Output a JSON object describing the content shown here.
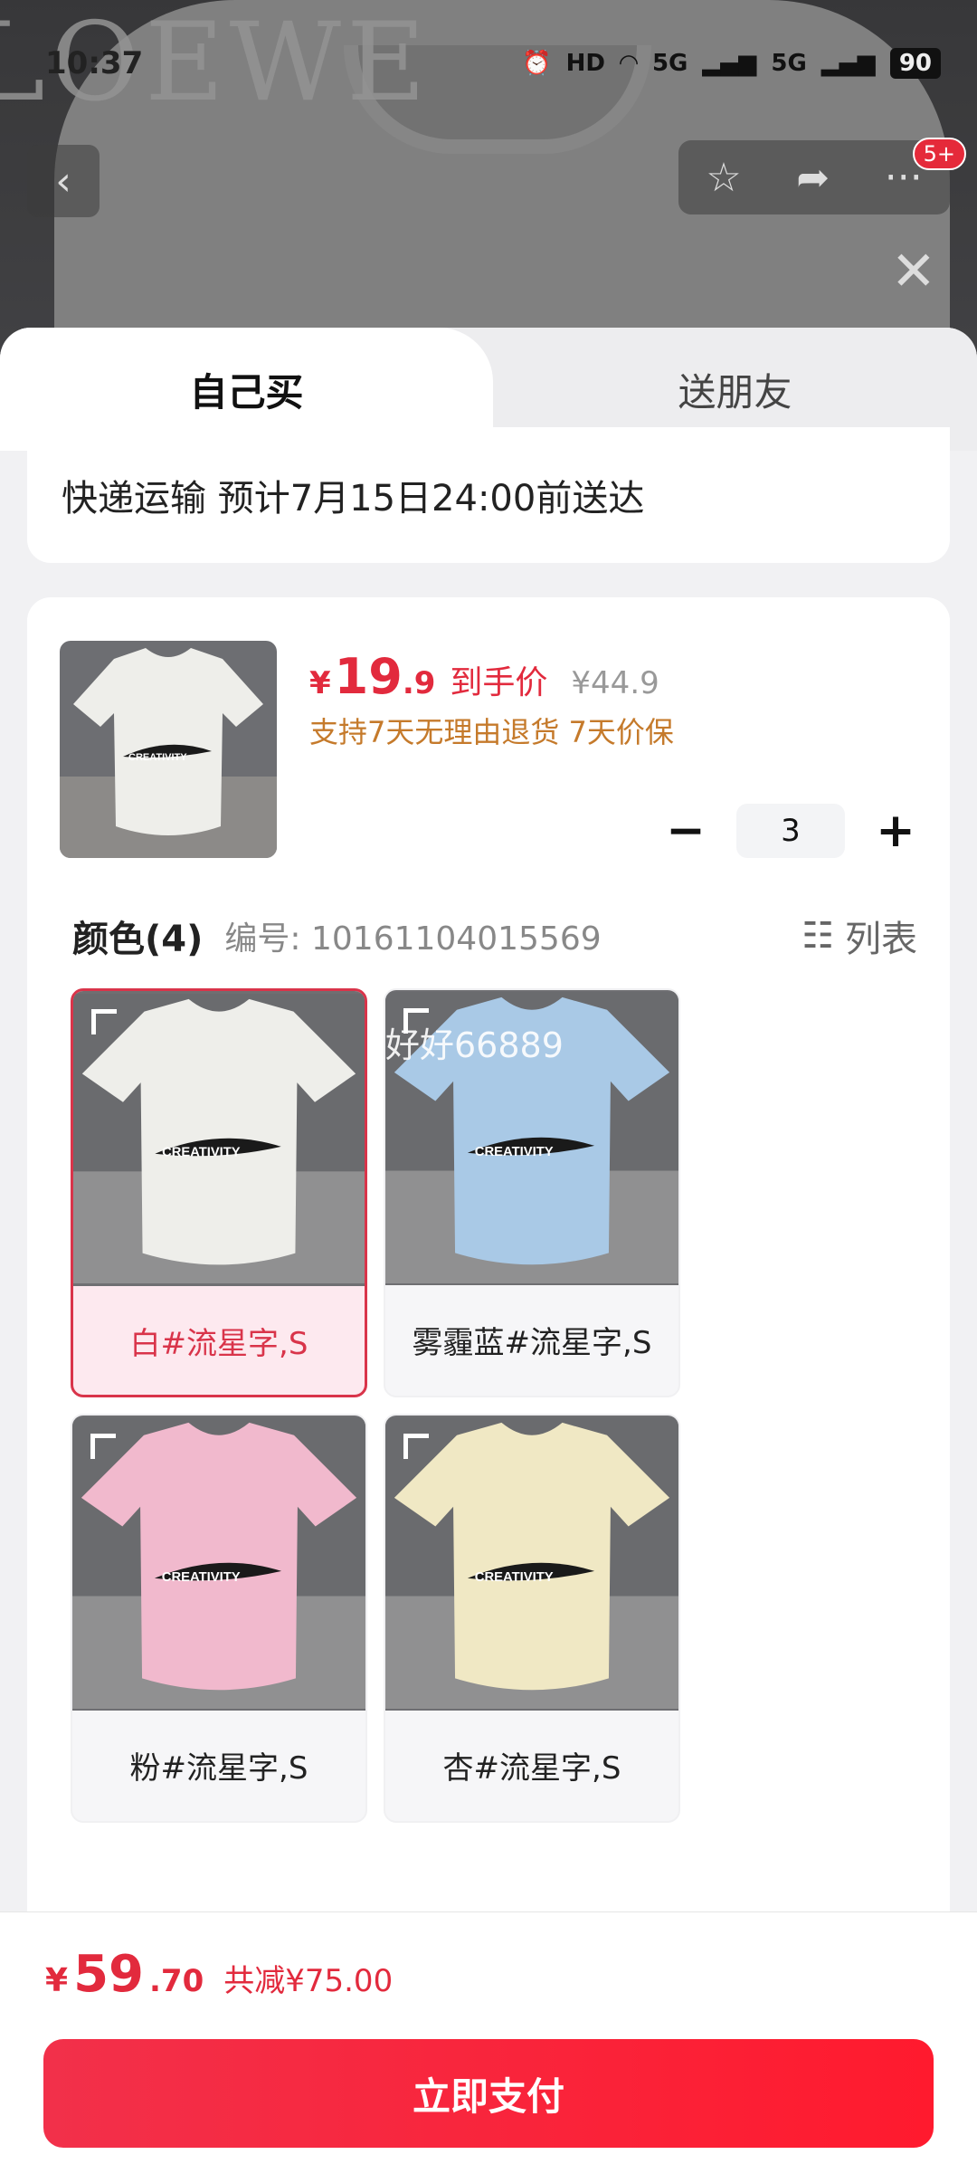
{
  "status_bar": {
    "time": "10:37",
    "hd": "HD",
    "signal_a": "5G",
    "signal_b": "5G",
    "battery": "90"
  },
  "header": {
    "back_icon": "chevron-left-icon",
    "badge": "5+"
  },
  "tabs": {
    "self": "自己买",
    "friend": "送朋友"
  },
  "delivery": {
    "text": "快递运输 预计7月15日24:00前送达"
  },
  "product": {
    "currency": "¥",
    "price_int": "19",
    "price_dec": ".9",
    "price_label": "到手价",
    "orig_price": "¥44.9",
    "guarantee": "支持7天无理由退货 7天价保",
    "quantity": "3",
    "minus": "−",
    "plus": "+"
  },
  "colors": {
    "title": "颜色(4)",
    "code": "编号: 10161104015569",
    "list_label": "列表",
    "watermark": "好好66889",
    "items": [
      {
        "label": "白#流星字,S",
        "color": "#eeeeea"
      },
      {
        "label": "雾霾蓝#流星字,S",
        "color": "#a9c9e6"
      },
      {
        "label": "粉#流星字,S",
        "color": "#f1b9cd"
      },
      {
        "label": "杏#流星字,S",
        "color": "#f0e8c4"
      }
    ]
  },
  "footer": {
    "currency": "¥",
    "total_int": "59",
    "total_dec": ".70",
    "save": "共减¥75.00",
    "pay_label": "立即支付"
  }
}
